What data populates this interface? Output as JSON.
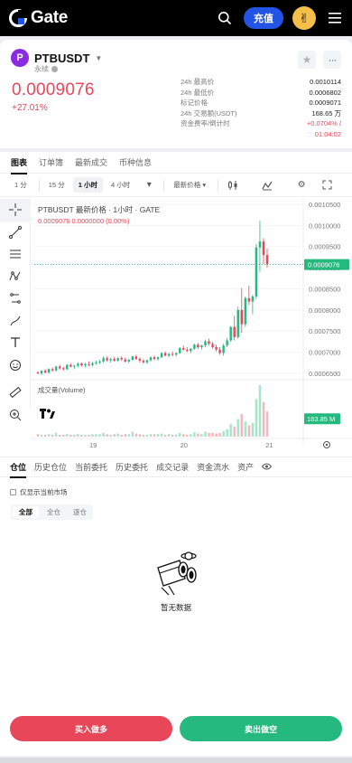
{
  "header": {
    "logo_text": "Gate",
    "deposit_label": "充值",
    "search_icon": "search-icon",
    "menu_icon": "menu-icon",
    "avatar_icon": "avatar"
  },
  "ticker": {
    "symbol": "PTBUSDT",
    "symbol_logo_letter": "P",
    "contract_type": "永续",
    "last_price": "0.0009076",
    "change_pct": "+27.01%",
    "stats": [
      {
        "label": "24h 最高价",
        "value": "0.0010114"
      },
      {
        "label": "24h 最低价",
        "value": "0.0006802"
      },
      {
        "label": "标记价格",
        "value": "0.0009071"
      },
      {
        "label": "24h 交易额(USDT)",
        "value": "168.65 万"
      },
      {
        "label": "资金费率/倒计时",
        "value": "+0.0704% /"
      },
      {
        "label": "",
        "value": "01:04:02"
      }
    ],
    "colors": {
      "up": "#25b980",
      "down": "#e8475a"
    }
  },
  "chart_tabs": [
    "图表",
    "订单簿",
    "最新成交",
    "币种信息"
  ],
  "chart_tab_active": 0,
  "interval_bar": {
    "items": [
      "1 分",
      "15 分",
      "1 小时",
      "4 小时"
    ],
    "active": 2,
    "price_type": "最新价格"
  },
  "chart_header": {
    "title": "PTBUSDT 最新价格 · 1小时 · GATE",
    "subtitle": "0.0009076  0.0000000 (0.00%)",
    "volume_label": "成交量(Volume)",
    "tv_logo": "TV"
  },
  "chart_data": {
    "type": "candlestick",
    "price_axis_ticks": [
      "0.0010500",
      "0.0010000",
      "0.0009500",
      "0.0009000",
      "0.0008500",
      "0.0008000",
      "0.0007500",
      "0.0007000",
      "0.0006500"
    ],
    "price_ylim": [
      0.000635,
      0.00105
    ],
    "last_price_label": "0.0009076",
    "volume_label": "183.85 M",
    "x_ticks": [
      "19",
      "20",
      "21"
    ],
    "candles": [
      [
        0.000652,
        0.000655,
        0.000648,
        0.00065
      ],
      [
        0.00065,
        0.000658,
        0.000646,
        0.000656
      ],
      [
        0.000656,
        0.00066,
        0.00065,
        0.000652
      ],
      [
        0.000652,
        0.000662,
        0.000649,
        0.00066
      ],
      [
        0.00066,
        0.000664,
        0.000654,
        0.000657
      ],
      [
        0.000657,
        0.000668,
        0.000655,
        0.000666
      ],
      [
        0.000666,
        0.00067,
        0.000659,
        0.000662
      ],
      [
        0.000662,
        0.000666,
        0.000656,
        0.00066
      ],
      [
        0.00066,
        0.000672,
        0.000658,
        0.00067
      ],
      [
        0.00067,
        0.000674,
        0.000664,
        0.000666
      ],
      [
        0.000666,
        0.00067,
        0.00066,
        0.000668
      ],
      [
        0.000668,
        0.000676,
        0.000664,
        0.000673
      ],
      [
        0.000673,
        0.000676,
        0.000666,
        0.000669
      ],
      [
        0.000669,
        0.000675,
        0.000664,
        0.000672
      ],
      [
        0.000672,
        0.000678,
        0.000667,
        0.00067
      ],
      [
        0.00067,
        0.000677,
        0.000666,
        0.000674
      ],
      [
        0.000674,
        0.00068,
        0.00067,
        0.000676
      ],
      [
        0.000676,
        0.000682,
        0.000672,
        0.000678
      ],
      [
        0.000678,
        0.00069,
        0.000675,
        0.000686
      ],
      [
        0.000686,
        0.00069,
        0.000678,
        0.000681
      ],
      [
        0.000681,
        0.000686,
        0.000676,
        0.000684
      ],
      [
        0.000684,
        0.000689,
        0.000678,
        0.00068
      ],
      [
        0.00068,
        0.000688,
        0.000677,
        0.000686
      ],
      [
        0.000686,
        0.00069,
        0.00068,
        0.000683
      ],
      [
        0.000683,
        0.000687,
        0.000676,
        0.000678
      ],
      [
        0.000678,
        0.000684,
        0.000674,
        0.000682
      ],
      [
        0.000682,
        0.000692,
        0.00068,
        0.00069
      ],
      [
        0.00069,
        0.000694,
        0.000682,
        0.000684
      ],
      [
        0.000684,
        0.000688,
        0.000676,
        0.00068
      ],
      [
        0.00068,
        0.000684,
        0.000673,
        0.000676
      ],
      [
        0.000676,
        0.000683,
        0.000672,
        0.000681
      ],
      [
        0.000681,
        0.00069,
        0.000678,
        0.000688
      ],
      [
        0.000688,
        0.000692,
        0.000681,
        0.000684
      ],
      [
        0.000684,
        0.00069,
        0.00068,
        0.000688
      ],
      [
        0.000688,
        0.0007,
        0.000686,
        0.000698
      ],
      [
        0.000698,
        0.000702,
        0.00069,
        0.000692
      ],
      [
        0.000692,
        0.000698,
        0.000688,
        0.000696
      ],
      [
        0.000696,
        0.000702,
        0.00069,
        0.000694
      ],
      [
        0.000694,
        0.0007,
        0.00069,
        0.000698
      ],
      [
        0.000698,
        0.000712,
        0.000696,
        0.00071
      ],
      [
        0.00071,
        0.000716,
        0.000704,
        0.000706
      ],
      [
        0.000706,
        0.000712,
        0.0007,
        0.000703
      ],
      [
        0.000703,
        0.00071,
        0.000698,
        0.000708
      ],
      [
        0.000708,
        0.00072,
        0.000706,
        0.000718
      ],
      [
        0.000718,
        0.000722,
        0.000708,
        0.000712
      ],
      [
        0.000712,
        0.000718,
        0.000706,
        0.000716
      ],
      [
        0.000716,
        0.00073,
        0.000712,
        0.000726
      ],
      [
        0.000726,
        0.000732,
        0.000716,
        0.00072
      ],
      [
        0.00072,
        0.000724,
        0.000708,
        0.000712
      ],
      [
        0.000712,
        0.000718,
        0.000702,
        0.000706
      ],
      [
        0.000706,
        0.000712,
        0.000694,
        0.000698
      ],
      [
        0.000698,
        0.00072,
        0.000692,
        0.000716
      ],
      [
        0.000716,
        0.000734,
        0.000712,
        0.000728
      ],
      [
        0.000728,
        0.000762,
        0.000724,
        0.00076
      ],
      [
        0.00076,
        0.000786,
        0.000728,
        0.000736
      ],
      [
        0.000736,
        0.000808,
        0.000732,
        0.0008
      ],
      [
        0.0008,
        0.000852,
        0.000746,
        0.000766
      ],
      [
        0.000766,
        0.000832,
        0.00076,
        0.000828
      ],
      [
        0.000828,
        0.000858,
        0.000812,
        0.00082
      ],
      [
        0.00082,
        0.000836,
        0.00079,
        0.000832
      ],
      [
        0.000832,
        0.000956,
        0.000826,
        0.000948
      ],
      [
        0.000948,
        0.001011,
        0.00089,
        0.000962
      ],
      [
        0.000962,
        0.00097,
        0.000908,
        0.00093
      ],
      [
        0.00093,
        0.000946,
        0.0009,
        0.000908
      ]
    ],
    "volumes": [
      4,
      3,
      3,
      4,
      3,
      6,
      3,
      3,
      4,
      3,
      3,
      4,
      3,
      3,
      3,
      4,
      4,
      4,
      6,
      4,
      3,
      4,
      5,
      3,
      4,
      4,
      8,
      5,
      4,
      3,
      3,
      4,
      4,
      4,
      5,
      3,
      4,
      3,
      3,
      6,
      4,
      3,
      4,
      7,
      5,
      4,
      8,
      6,
      6,
      5,
      6,
      9,
      12,
      20,
      16,
      28,
      36,
      24,
      18,
      22,
      60,
      82,
      55,
      40
    ],
    "volume_ylim": [
      0,
      85
    ]
  },
  "positions": {
    "tabs": [
      "仓位",
      "历史仓位",
      "当前委托",
      "历史委托",
      "成交记录",
      "资金流水",
      "资产"
    ],
    "active_tab": 0,
    "only_current_label": "仅显示当前市场",
    "modes": [
      "全部",
      "全仓",
      "逐仓"
    ],
    "active_mode": 0,
    "empty_text": "暂无数据",
    "buy_label": "买入做多",
    "sell_label": "卖出做空"
  }
}
